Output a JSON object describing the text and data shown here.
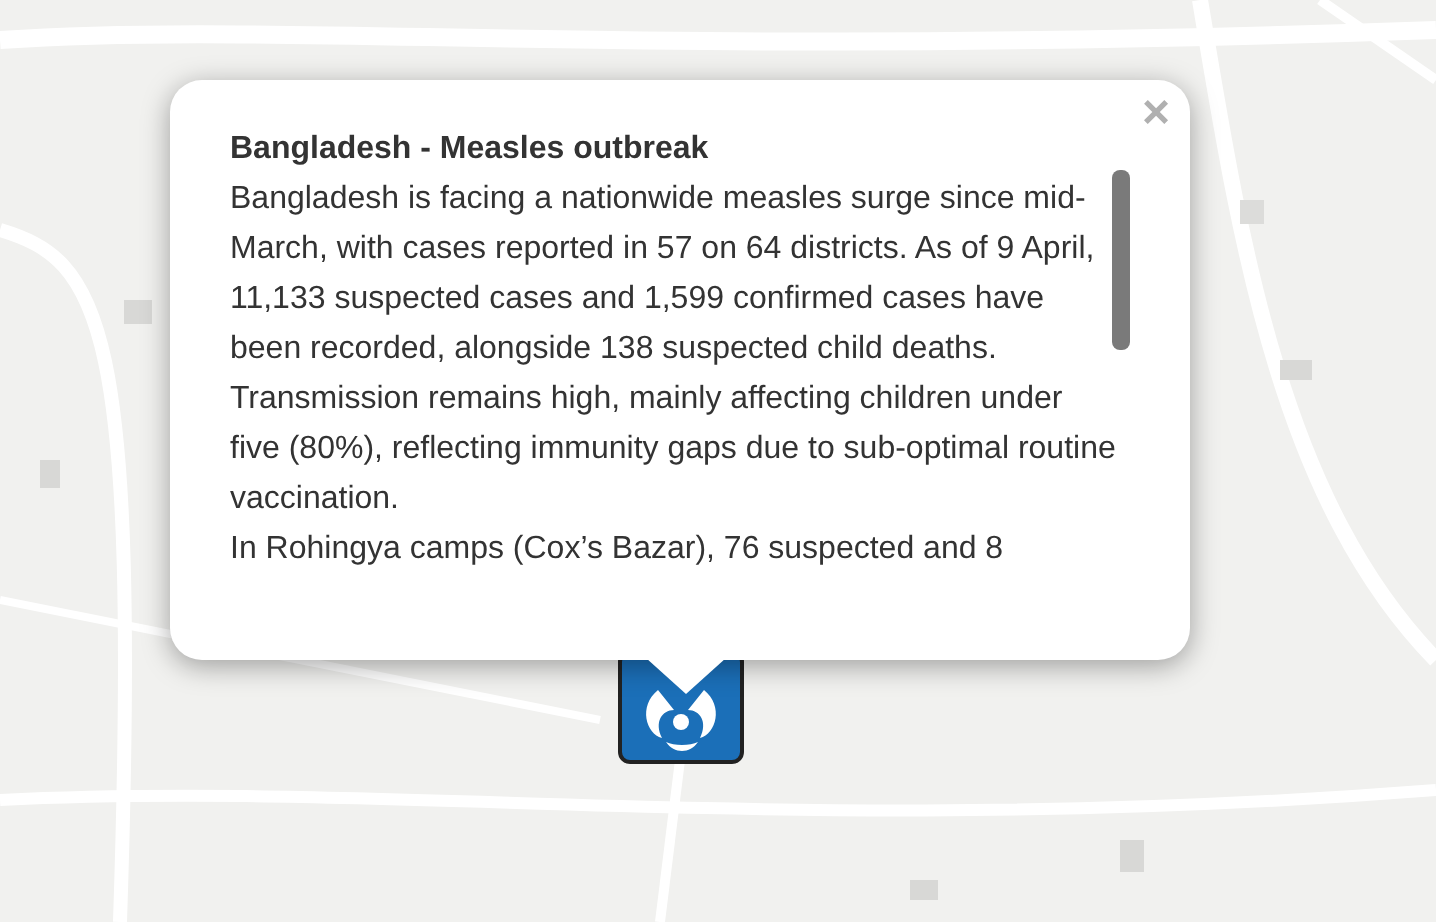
{
  "popup": {
    "title": "Bangladesh - Measles outbreak",
    "paragraphs": [
      "Bangladesh is facing a nationwide measles surge since mid-March, with cases reported in 57 on 64 districts. As of 9 April, 11,133 suspected cases and 1,599 confirmed cases have been recorded, alongside 138 suspected child deaths.",
      "Transmission remains high, mainly affecting children under five (80%), reflecting immunity gaps due to sub-optimal routine vaccination.",
      "In Rohingya camps (Cox’s Bazar), 76 suspected and 8"
    ],
    "close": "×"
  }
}
